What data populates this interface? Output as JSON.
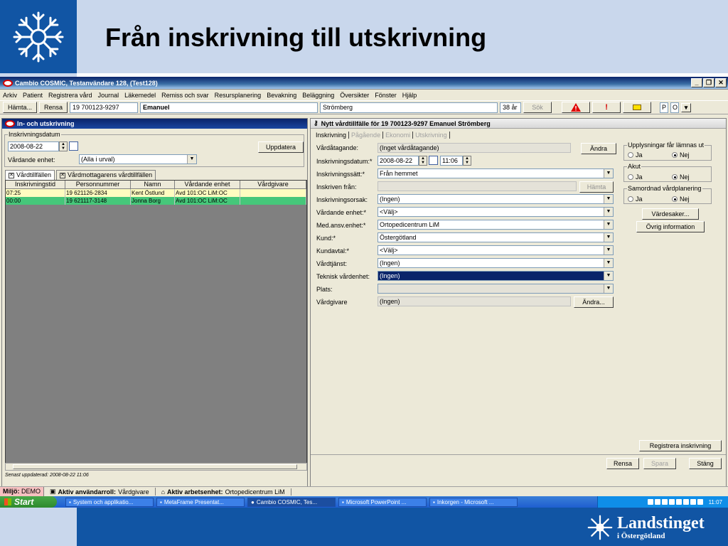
{
  "slide": {
    "title": "Från inskrivning till utskrivning",
    "bottom_logo_name": "Landstinget",
    "bottom_logo_sub": "i Östergötland"
  },
  "app": {
    "title": "Cambio COSMIC, Testanvändare 128, (Test128)",
    "menu": [
      "Arkiv",
      "Patient",
      "Registrera vård",
      "Journal",
      "Läkemedel",
      "Remiss och svar",
      "Resursplanering",
      "Bevakning",
      "Beläggning",
      "Översikter",
      "Fönster",
      "Hjälp"
    ],
    "toolbar": {
      "fetch": "Hämta...",
      "clear": "Rensa",
      "pnr": "19 700123-9297",
      "firstname": "Emanuel",
      "lastname": "Strömberg",
      "age": "38 år",
      "search": "Sök",
      "warn_exclaim": "!",
      "letter_p": "P",
      "letter_o": "O"
    }
  },
  "left": {
    "title": "In- och utskrivning",
    "group_label": "Inskrivningsdatum",
    "date": "2008-08-22",
    "update_btn": "Uppdatera",
    "unit_label": "Vårdande enhet:",
    "unit_value": "(Alla i urval)",
    "tab1": "Vårdtillfällen",
    "tab2": "Vårdmottagarens vårdtillfällen",
    "columns": [
      "Inskrivningstid",
      "Personnummer",
      "Namn",
      "Vårdande enhet",
      "Vårdgivare"
    ],
    "rows": [
      {
        "time": "07:25",
        "pnr": "19 621126-2834",
        "name": "Kent Östlund",
        "unit": "Avd 101:OC LiM:OC",
        "giver": ""
      },
      {
        "time": "00:00",
        "pnr": "19 621117-3148",
        "name": "Jonna Borg",
        "unit": "Avd 101:OC LiM:OC",
        "giver": ""
      }
    ],
    "status": "Senast uppdaterad: 2008-08-22 11:06"
  },
  "right": {
    "title": "Nytt vårdtillfälle för 19 700123-9297 Emanuel Strömberg",
    "tabs": [
      "Inskrivning",
      "Pågående",
      "Ekonomi",
      "Utskrivning"
    ],
    "fields": {
      "vardatagande_label": "Vårdåtagande:",
      "vardatagande_value": "(Inget vårdåtagande)",
      "andra": "Ändra",
      "datum_label": "Inskrivningsdatum:*",
      "datum_value": "2008-08-22",
      "time_value": "11:06",
      "satt_label": "Inskrivningssätt:*",
      "satt_value": "Från hemmet",
      "fran_label": "Inskriven från:",
      "hamta": "Hämta",
      "orsak_label": "Inskrivningsorsak:",
      "orsak_value": "(Ingen)",
      "enhet_label": "Vårdande enhet:*",
      "enhet_value": "<Välj>",
      "med_label": "Med.ansv.enhet:*",
      "med_value": "Ortopedicentrum LiM",
      "kund_label": "Kund:*",
      "kund_value": "Östergötland",
      "avtal_label": "Kundavtal:*",
      "avtal_value": "<Välj>",
      "tjanst_label": "Vårdtjänst:",
      "tjanst_value": "(Ingen)",
      "teknisk_label": "Teknisk vårdenhet:",
      "teknisk_value": "(Ingen)",
      "plats_label": "Plats:",
      "givare_label": "Vårdgivare",
      "givare_value": "(Ingen)",
      "andra2": "Ändra..."
    },
    "side": {
      "upplys_label": "Upplysningar får lämnas ut",
      "akut_label": "Akut",
      "samordnad_label": "Samordnad vårdplanering",
      "ja": "Ja",
      "nej": "Nej",
      "vardesaker": "Värdesaker...",
      "ovrig": "Övrig information"
    },
    "register_btn": "Registrera inskrivning",
    "bottom": {
      "rensa": "Rensa",
      "spara": "Spara",
      "stang": "Stäng"
    }
  },
  "status": {
    "miljo_label": "Miljö:",
    "miljo_value": "DEMO",
    "roll_label": "Aktiv användarroll:",
    "roll_value": "Vårdgivare",
    "enhet_label": "Aktiv arbetsenhet:",
    "enhet_value": "Ortopedicentrum LiM"
  },
  "taskbar": {
    "start": "Start",
    "tasks": [
      "System och applikatio...",
      "MetaFrame Presentat...",
      "Cambio COSMIC, Tes...",
      "Microsoft PowerPoint ...",
      "Inkorgen - Microsoft ..."
    ],
    "clock": "11:07"
  }
}
